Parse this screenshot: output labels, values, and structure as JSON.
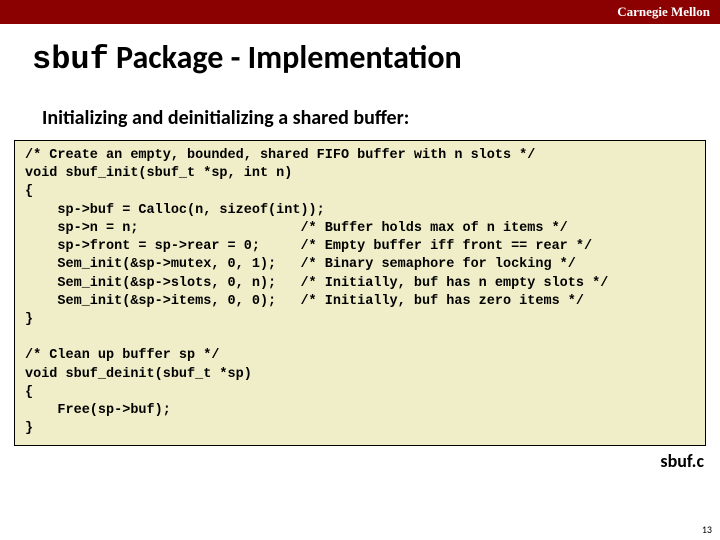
{
  "header": {
    "org": "Carnegie Mellon"
  },
  "title": {
    "code": "sbuf",
    "rest": " Package - Implementation"
  },
  "subtitle": "Initializing and deinitializing a shared buffer:",
  "code": "/* Create an empty, bounded, shared FIFO buffer with n slots */\nvoid sbuf_init(sbuf_t *sp, int n)\n{\n    sp->buf = Calloc(n, sizeof(int));\n    sp->n = n;                    /* Buffer holds max of n items */\n    sp->front = sp->rear = 0;     /* Empty buffer iff front == rear */\n    Sem_init(&sp->mutex, 0, 1);   /* Binary semaphore for locking */\n    Sem_init(&sp->slots, 0, n);   /* Initially, buf has n empty slots */\n    Sem_init(&sp->items, 0, 0);   /* Initially, buf has zero items */\n}\n\n/* Clean up buffer sp */\nvoid sbuf_deinit(sbuf_t *sp)\n{\n    Free(sp->buf);\n}",
  "filename": "sbuf.c",
  "page": "13"
}
